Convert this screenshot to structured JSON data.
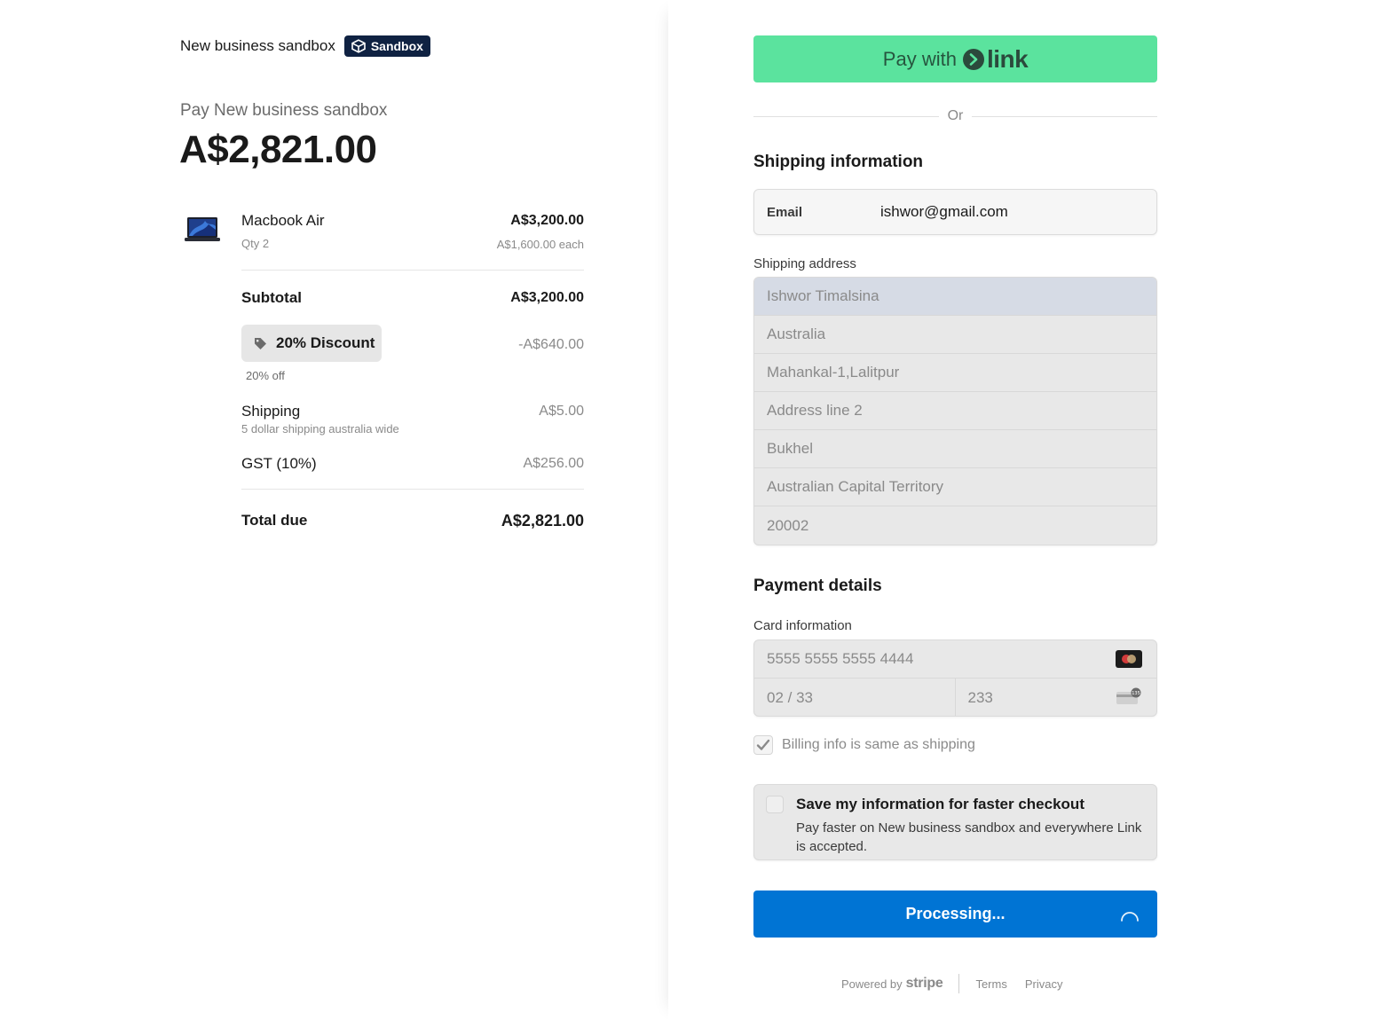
{
  "merchant": {
    "name": "New business sandbox",
    "badge": "Sandbox"
  },
  "summary": {
    "pay_label": "Pay New business sandbox",
    "amount": "A$2,821.00"
  },
  "product": {
    "name": "Macbook Air",
    "qty": "Qty 2",
    "price": "A$3,200.00",
    "each": "A$1,600.00 each",
    "thumb_icon": "laptop-thumbnail"
  },
  "totals": {
    "subtotal_label": "Subtotal",
    "subtotal_value": "A$3,200.00",
    "discount_label": "20% Discount",
    "discount_value": "-A$640.00",
    "discount_off": "20% off",
    "shipping_label": "Shipping",
    "shipping_desc": "5 dollar shipping australia wide",
    "shipping_value": "A$5.00",
    "gst_label": "GST (10%)",
    "gst_value": "A$256.00",
    "total_label": "Total due",
    "total_value": "A$2,821.00"
  },
  "link_button": {
    "pay_with": "Pay with",
    "link": "link",
    "color": "#5be39e"
  },
  "or_text": "Or",
  "shipping_info": {
    "title": "Shipping information",
    "email_label": "Email",
    "email_value": "ishwor@gmail.com",
    "address_label": "Shipping address",
    "address": {
      "name": "Ishwor Timalsina",
      "country": "Australia",
      "line1": "Mahankal-1,Lalitpur",
      "line2_placeholder": "Address line 2",
      "city": "Bukhel",
      "state": "Australian Capital Territory",
      "postcode": "20002"
    }
  },
  "payment": {
    "title": "Payment details",
    "card_label": "Card information",
    "card_number": "5555 5555 5555 4444",
    "expiry": "02 / 33",
    "cvc": "233",
    "cvc_badge": "135",
    "billing_same": "Billing info is same as shipping",
    "billing_checked": true
  },
  "save_info": {
    "title": "Save my information for faster checkout",
    "desc": "Pay faster on New business sandbox and everywhere Link is accepted."
  },
  "submit": {
    "label": "Processing...",
    "color": "#0074d4"
  },
  "footer": {
    "powered_by": "Powered by",
    "stripe": "stripe",
    "terms": "Terms",
    "privacy": "Privacy"
  }
}
